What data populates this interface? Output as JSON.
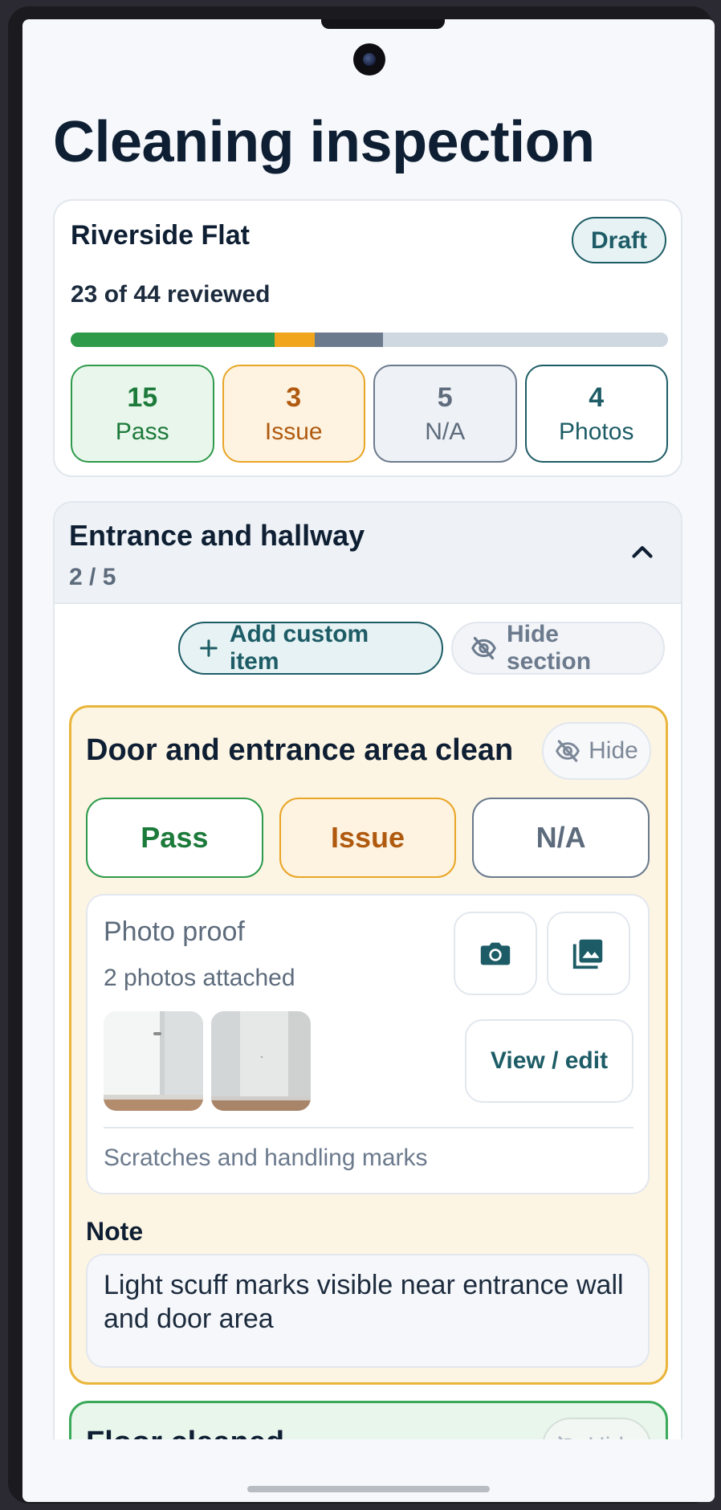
{
  "page": {
    "title": "Cleaning inspection"
  },
  "summary": {
    "property": "Riverside Flat",
    "status": "Draft",
    "reviewed_text": "23 of 44 reviewed",
    "progress": {
      "total": 44,
      "pass": 15,
      "issue": 3,
      "na": 5
    },
    "colors": {
      "pass": "#2e9a4a",
      "issue": "#f0a51c",
      "na": "#6b7a8d",
      "track": "#cfd7e1"
    },
    "stats": [
      {
        "num": "15",
        "label": "Pass"
      },
      {
        "num": "3",
        "label": "Issue"
      },
      {
        "num": "5",
        "label": "N/A"
      },
      {
        "num": "4",
        "label": "Photos"
      }
    ]
  },
  "section": {
    "title": "Entrance and hallway",
    "count": "2 / 5",
    "add_label": "Add custom item",
    "hide_label": "Hide section",
    "item": {
      "title": "Door and entrance area clean",
      "hide_label": "Hide",
      "choices": [
        "Pass",
        "Issue",
        "N/A"
      ],
      "selected": "Issue",
      "photo_title": "Photo proof",
      "photo_count": "2 photos attached",
      "view_label": "View / edit",
      "photo_caption": "Scratches and handling marks",
      "note_label": "Note",
      "note_text": "Light scuff marks visible near entrance wall and door area"
    },
    "next_item": {
      "title": "Floor cleaned",
      "hide_label": "Hide"
    }
  },
  "icons": [
    "camera-icon",
    "gallery-icon",
    "plus-icon",
    "eye-off-icon",
    "chevron-up-icon"
  ]
}
